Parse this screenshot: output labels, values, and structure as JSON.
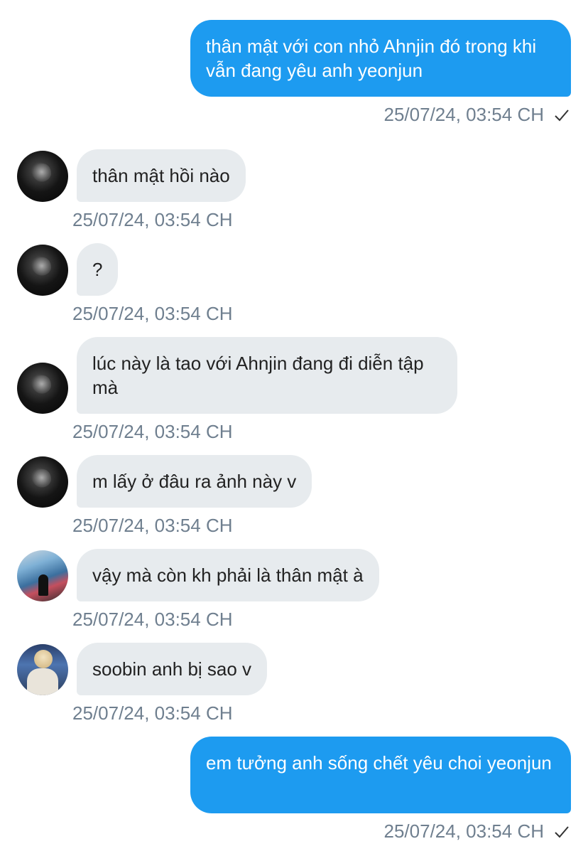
{
  "messages": [
    {
      "direction": "out",
      "text": "thân mật với con nhỏ Ahnjin đó trong khi vẫn đang yêu anh yeonjun",
      "time": "25/07/24, 03:54 CH",
      "read_icon": "checkmark-icon"
    },
    {
      "direction": "in",
      "avatar": "dark-portrait",
      "text": "thân mật hồi nào",
      "time": "25/07/24, 03:54 CH"
    },
    {
      "direction": "in",
      "avatar": "dark-portrait",
      "text": "?",
      "time": "25/07/24, 03:54 CH"
    },
    {
      "direction": "in",
      "avatar": "dark-portrait",
      "text": "lúc này là tao với Ahnjin đang đi diễn tập mà",
      "time": "25/07/24, 03:54 CH"
    },
    {
      "direction": "in",
      "avatar": "dark-portrait",
      "text": "m lấy ở đâu ra ảnh này v",
      "time": "25/07/24, 03:54 CH"
    },
    {
      "direction": "in",
      "avatar": "graffiti-portrait",
      "text": "vậy mà còn kh phải là thân mật à",
      "time": "25/07/24, 03:54 CH"
    },
    {
      "direction": "in",
      "avatar": "blond-portrait",
      "text": "soobin anh bị sao v",
      "time": "25/07/24, 03:54 CH"
    },
    {
      "direction": "out",
      "text": "em tưởng anh sống chết yêu choi yeonjun",
      "time": "25/07/24, 03:54 CH",
      "read_icon": "checkmark-icon"
    }
  ],
  "colors": {
    "outgoing_bubble": "#1d9bf0",
    "incoming_bubble": "#e7ebee",
    "timestamp": "#6f7f8f"
  }
}
